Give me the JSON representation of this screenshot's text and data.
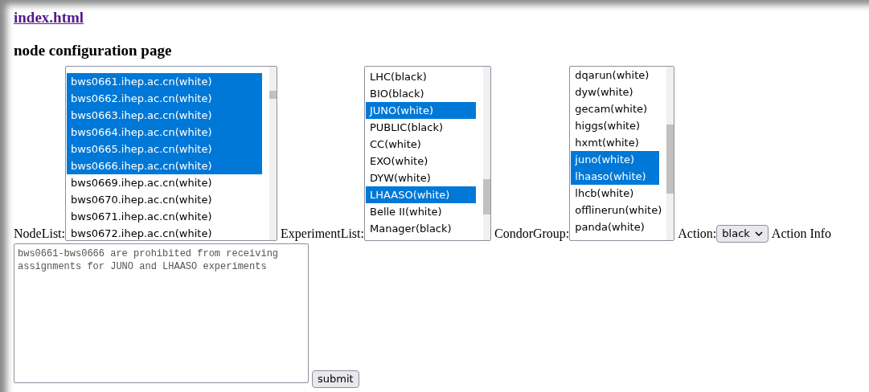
{
  "link": "index.html",
  "heading": "node configuration page",
  "lists": [
    {
      "label": "NodeList:",
      "items": [
        {
          "text": "bws0661.ihep.ac.cn(white)",
          "selected": true
        },
        {
          "text": "bws0662.ihep.ac.cn(white)",
          "selected": true
        },
        {
          "text": "bws0663.ihep.ac.cn(white)",
          "selected": true
        },
        {
          "text": "bws0664.ihep.ac.cn(white)",
          "selected": true
        },
        {
          "text": "bws0665.ihep.ac.cn(white)",
          "selected": true
        },
        {
          "text": "bws0666.ihep.ac.cn(white)",
          "selected": true
        },
        {
          "text": "bws0669.ihep.ac.cn(white)",
          "selected": false
        },
        {
          "text": "bws0670.ihep.ac.cn(white)",
          "selected": false
        },
        {
          "text": "bws0671.ihep.ac.cn(white)",
          "selected": false
        },
        {
          "text": "bws0672.ihep.ac.cn(white)",
          "selected": false
        }
      ]
    },
    {
      "label": "ExperimentList:",
      "items": [
        {
          "text": "LHC(black)",
          "selected": false
        },
        {
          "text": "BIO(black)",
          "selected": false
        },
        {
          "text": "JUNO(white)",
          "selected": true
        },
        {
          "text": "PUBLIC(black)",
          "selected": false
        },
        {
          "text": "CC(white)",
          "selected": false
        },
        {
          "text": "EXO(white)",
          "selected": false
        },
        {
          "text": "DYW(white)",
          "selected": false
        },
        {
          "text": "LHAASO(white)",
          "selected": true
        },
        {
          "text": "Belle II(white)",
          "selected": false
        },
        {
          "text": "Manager(black)",
          "selected": false
        }
      ]
    },
    {
      "label": "CondorGroup:",
      "items": [
        {
          "text": "dqarun(white)",
          "selected": false
        },
        {
          "text": "dyw(white)",
          "selected": false
        },
        {
          "text": "gecam(white)",
          "selected": false
        },
        {
          "text": "higgs(white)",
          "selected": false
        },
        {
          "text": "hxmt(white)",
          "selected": false
        },
        {
          "text": "juno(white)",
          "selected": true
        },
        {
          "text": "lhaaso(white)",
          "selected": true
        },
        {
          "text": "lhcb(white)",
          "selected": false
        },
        {
          "text": "offlinerun(white)",
          "selected": false
        },
        {
          "text": "panda(white)",
          "selected": false
        }
      ]
    }
  ],
  "action": {
    "label": "Action:",
    "value": "black"
  },
  "action_info_label": "Action Info",
  "textarea": {
    "value": "bws0661-bws0666 are prohibited from receiving assignments for JUNO and LHAASO experiments"
  },
  "submit": "submit"
}
